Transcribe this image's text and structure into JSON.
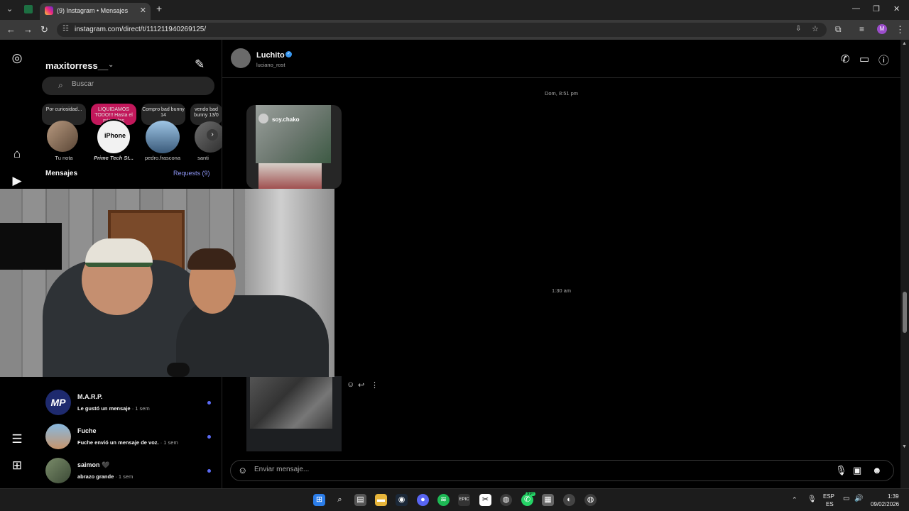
{
  "browser": {
    "tab_title": "(9) Instagram • Mensajes",
    "url": "instagram.com/direct/t/111211940269125/",
    "profile_initial": "M"
  },
  "sidebar": {
    "username": "maxitorress__",
    "search_placeholder": "Buscar",
    "notes": [
      {
        "text": "Por curiosidad..."
      },
      {
        "text": "LIQUIDAMOS TODO!!! Hasta el miercoles"
      },
      {
        "text": "Compro bad bunny 14"
      },
      {
        "text": "vendo bad bunny 13/0"
      }
    ],
    "stories": [
      {
        "name": "Tu nota"
      },
      {
        "name": "Prime Tech St..."
      },
      {
        "name": "pedro.frascona"
      },
      {
        "name": "santi"
      }
    ],
    "story_badge": "iPhone",
    "messages_title": "Mensajes",
    "requests_label": "Requests (9)",
    "conversations": [
      {
        "name": "M.A.R.P.",
        "preview": "Le gustó un mensaje",
        "age": " · 1 sem",
        "avatar_text": "MP"
      },
      {
        "name": "Fuche",
        "preview": "Fuche envió un mensaje de voz.",
        "age": " · 1 sem"
      },
      {
        "name": "saimon 🖤",
        "preview": "abrazo grande",
        "age": " · 1 sem"
      }
    ]
  },
  "chat": {
    "name": "Luchito",
    "handle": "luciano_rost",
    "timestamps": [
      "Dom, 8:51 pm",
      "1:30 am"
    ],
    "shared_post_user": "soy.chako",
    "composer_placeholder": "Enviar mensaje..."
  },
  "taskbar": {
    "lang_top": "ESP",
    "lang_bottom": "ES",
    "time": "1:39",
    "date": "09/02/2026",
    "whatsapp_badge": "99+"
  },
  "colors": {
    "accent_link": "#8e96f5",
    "unread_dot": "#5b6bf5",
    "verified": "#3897f0",
    "note_highlight": "#c2185b"
  }
}
